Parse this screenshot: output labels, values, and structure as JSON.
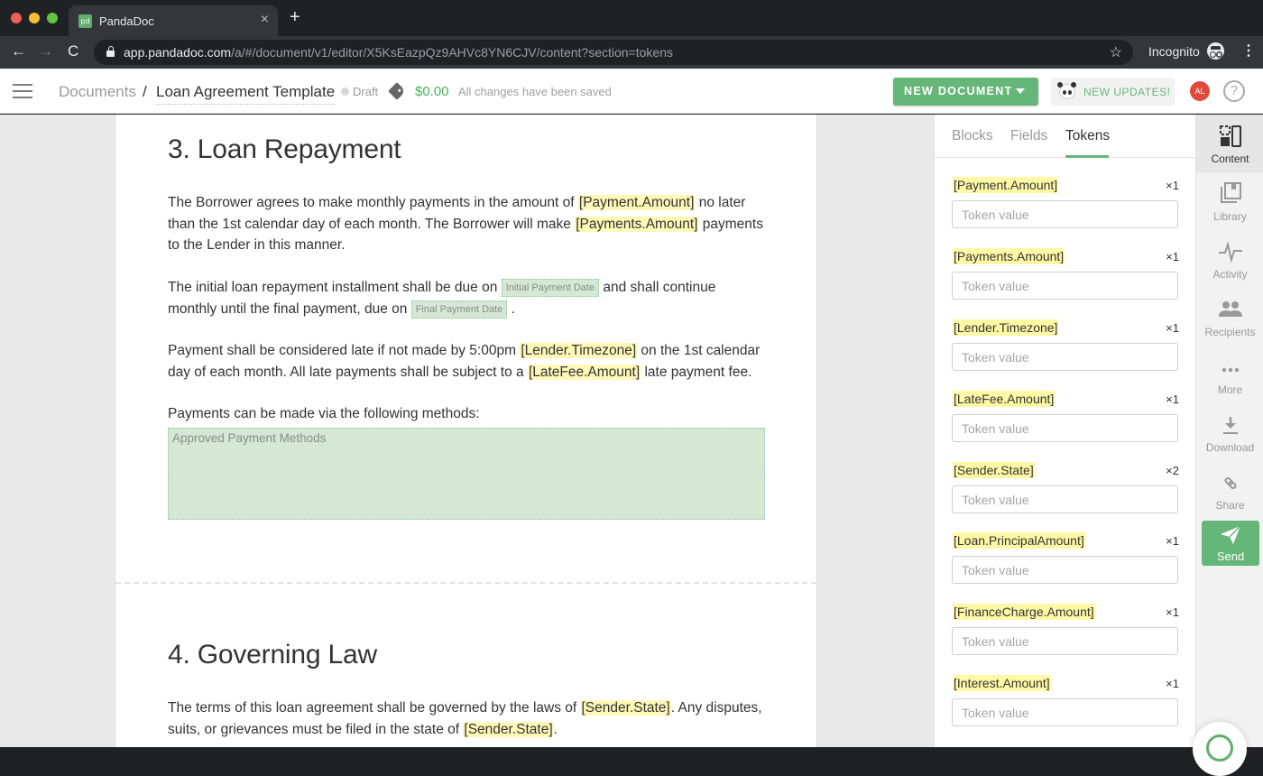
{
  "browser": {
    "tab_title": "PandaDoc",
    "tab_favicon": "pd",
    "tab_close": "×",
    "new_tab": "+",
    "url_host": "app.pandadoc.com",
    "url_path": "/a/#/document/v1/editor/X5KsEazpQz9AHVc8YN6CJV/content?section=tokens",
    "incognito_label": "Incognito",
    "icons": {
      "back": "←",
      "forward": "→",
      "reload": "C",
      "star": "☆",
      "menu": "⋮"
    }
  },
  "header": {
    "breadcrumb_root": "Documents",
    "breadcrumb_sep": "/",
    "document_title": "Loan Agreement Template",
    "status": "Draft",
    "price": "$0.00",
    "save_status": "All changes have been saved",
    "new_document_label": "NEW DOCUMENT",
    "new_updates_label": "NEW UPDATES!",
    "avatar_initials": "AL",
    "help_label": "?"
  },
  "document": {
    "section3": {
      "heading": "3. Loan Repayment",
      "p1": [
        "The Borrower agrees to make monthly payments in the amount of ",
        "[Payment.Amount]",
        " no later than the 1st calendar day of each month. The Borrower will make ",
        "[Payments.Amount]",
        " payments to the Lender in this manner."
      ],
      "p2": [
        "The initial loan repayment installment shall be due on ",
        "Initial Payment Date",
        " and shall continue monthly until the final payment, due on ",
        "Final Payment Date",
        " ."
      ],
      "p3": [
        "Payment shall be considered late if not made by 5:00pm ",
        "[Lender.Timezone]",
        " on the 1st calendar day of each month. All late payments shall be subject to a ",
        "[LateFee.Amount]",
        " late payment fee."
      ],
      "p4": "Payments can be made via the following methods:",
      "payment_methods_field": "Approved Payment Methods"
    },
    "section4": {
      "heading": "4. Governing Law",
      "p1": [
        "The terms of this loan agreement shall be governed by the laws of ",
        "[Sender.State]",
        ". Any disputes, suits, or grievances must be filed in the state of ",
        "[Sender.State]",
        "."
      ]
    }
  },
  "panel": {
    "tabs": [
      {
        "label": "Blocks",
        "active": false
      },
      {
        "label": "Fields",
        "active": false
      },
      {
        "label": "Tokens",
        "active": true
      }
    ],
    "tokens": [
      {
        "name": "[Payment.Amount]",
        "count": "×1",
        "value": "",
        "placeholder": "Token value"
      },
      {
        "name": "[Payments.Amount]",
        "count": "×1",
        "value": "",
        "placeholder": "Token value"
      },
      {
        "name": "[Lender.Timezone]",
        "count": "×1",
        "value": "",
        "placeholder": "Token value"
      },
      {
        "name": "[LateFee.Amount]",
        "count": "×1",
        "value": "",
        "placeholder": "Token value"
      },
      {
        "name": "[Sender.State]",
        "count": "×2",
        "value": "",
        "placeholder": "Token value"
      },
      {
        "name": "[Loan.PrincipalAmount]",
        "count": "×1",
        "value": "",
        "placeholder": "Token value"
      },
      {
        "name": "[FinanceCharge.Amount]",
        "count": "×1",
        "value": "",
        "placeholder": "Token value"
      },
      {
        "name": "[Interest.Amount]",
        "count": "×1",
        "value": "",
        "placeholder": "Token value"
      }
    ]
  },
  "rail": {
    "items": [
      {
        "label": "Content",
        "icon": "content-icon",
        "active": true
      },
      {
        "label": "Library",
        "icon": "library-icon",
        "active": false
      },
      {
        "label": "Activity",
        "icon": "activity-icon",
        "active": false
      },
      {
        "label": "Recipients",
        "icon": "recipients-icon",
        "active": false
      },
      {
        "label": "More",
        "icon": "more-icon",
        "active": false
      },
      {
        "label": "Download",
        "icon": "download-icon",
        "active": false
      },
      {
        "label": "Share",
        "icon": "share-icon",
        "active": false
      }
    ],
    "send_label": "Send"
  },
  "colors": {
    "brand_green": "#67b679",
    "token_highlight": "#fff9b8",
    "field_fill": "#d4e8d5",
    "avatar": "#e04a3b"
  }
}
